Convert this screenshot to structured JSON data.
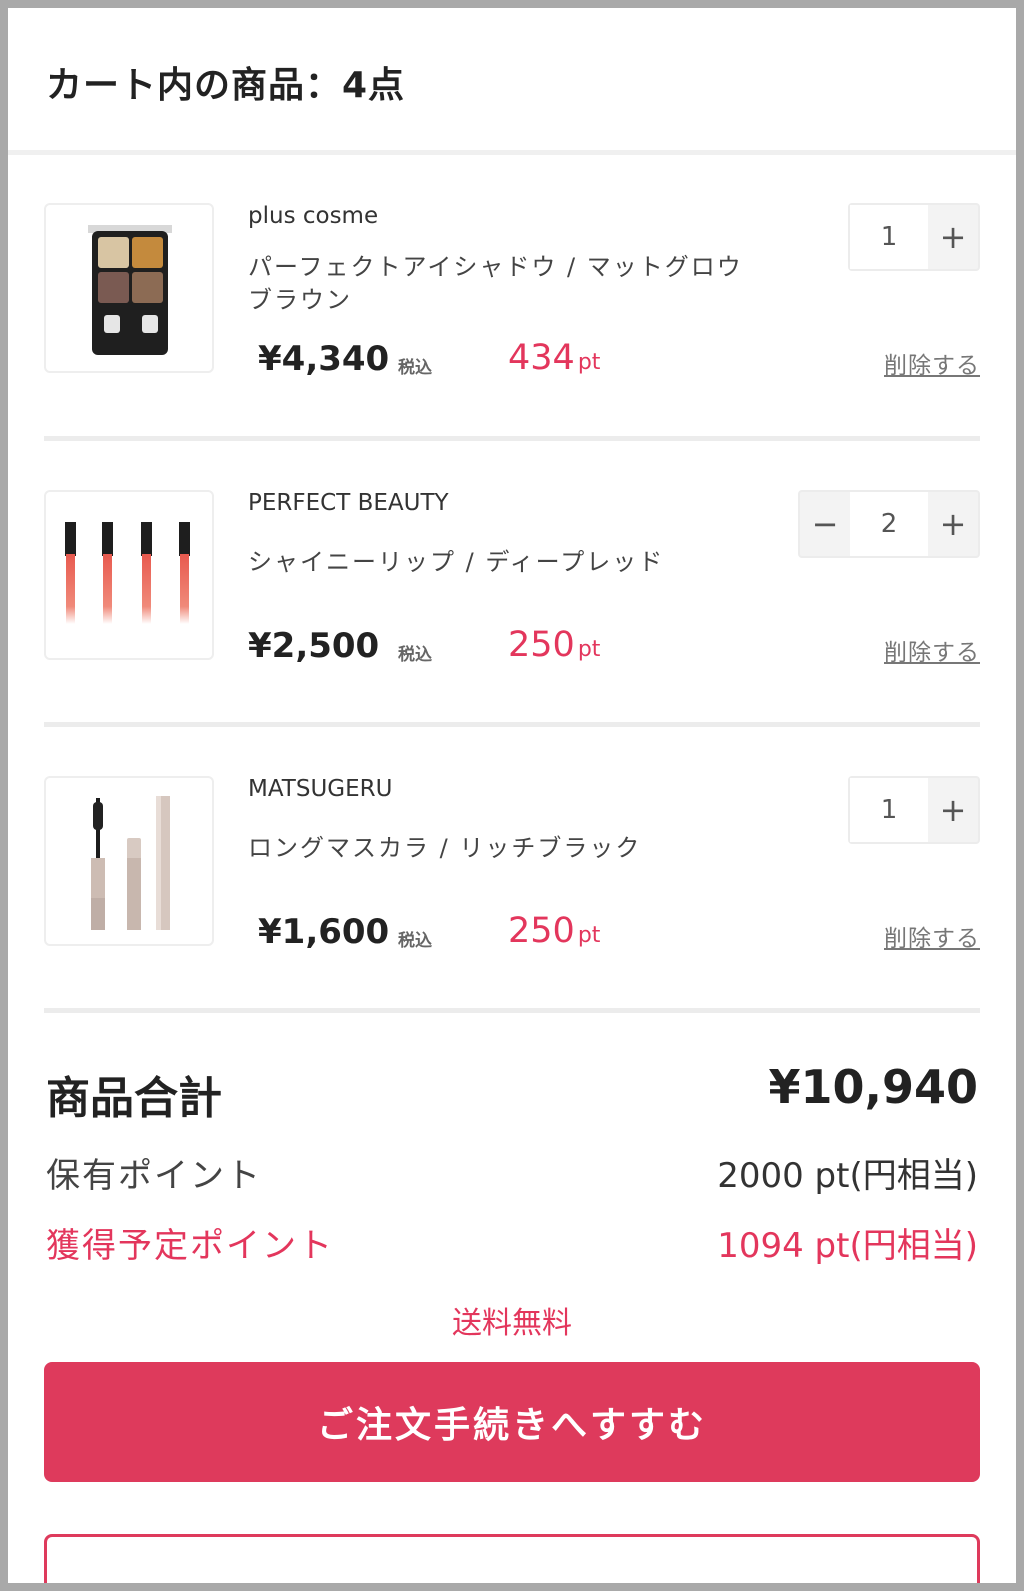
{
  "header": {
    "title": "カート内の商品：4点"
  },
  "items": [
    {
      "brand": "plus cosme",
      "name": "パーフェクトアイシャドウ / マットグロウブラウン",
      "price": "¥4,340",
      "tax_label": "税込",
      "points": "434",
      "points_unit": "pt",
      "quantity": "1",
      "plus_label": "+",
      "remove_label": "削除する",
      "thumb_icon": "eyeshadow-palette-icon"
    },
    {
      "brand": "PERFECT BEAUTY",
      "name": "シャイニーリップ / ディープレッド",
      "price": "¥2,500",
      "tax_label": "税込",
      "points": "250",
      "points_unit": "pt",
      "quantity": "2",
      "minus_label": "−",
      "plus_label": "+",
      "remove_label": "削除する",
      "thumb_icon": "lip-gloss-icon"
    },
    {
      "brand": "MATSUGERU",
      "name": "ロングマスカラ / リッチブラック",
      "price": "¥1,600",
      "tax_label": "税込",
      "points": "250",
      "points_unit": "pt",
      "quantity": "1",
      "plus_label": "+",
      "remove_label": "削除する",
      "thumb_icon": "mascara-icon"
    }
  ],
  "summary": {
    "subtotal_label": "商品合計",
    "subtotal_value": "¥10,940",
    "held_points_label": "保有ポイント",
    "held_points_value": "2000 pt(円相当)",
    "earned_points_label": "獲得予定ポイント",
    "earned_points_value": "1094 pt(円相当)",
    "shipping_label": "送料無料"
  },
  "actions": {
    "checkout_label": "ご注文手続きへすすむ"
  },
  "colors": {
    "accent": "#de3a5c",
    "points_text": "#e3365c"
  }
}
